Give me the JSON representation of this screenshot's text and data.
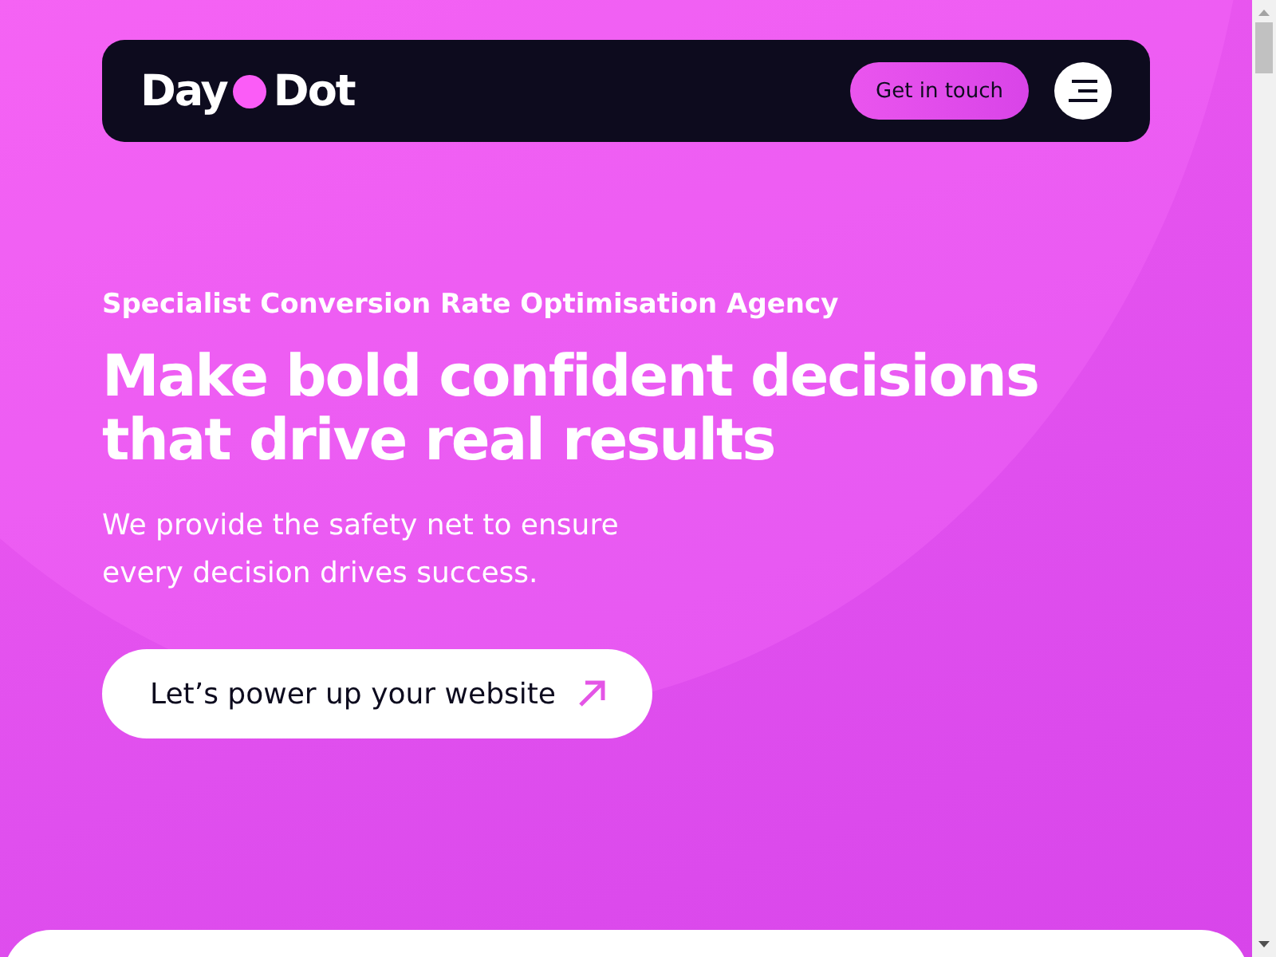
{
  "header": {
    "logo": {
      "first": "Day",
      "second": "Dot"
    },
    "cta": "Get in touch"
  },
  "hero": {
    "eyebrow": "Specialist Conversion Rate Optimisation Agency",
    "headline": "Make bold confident decisions that drive real results",
    "intro": "We provide the safety net to ensure every decision drives success.",
    "button": "Let’s power up your website"
  }
}
